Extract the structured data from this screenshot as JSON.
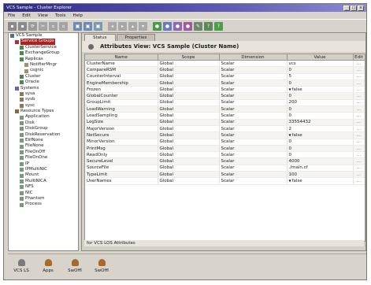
{
  "window": {
    "title": "VCS Sample - Cluster Explorer",
    "min": "_",
    "max": "□",
    "close": "×"
  },
  "menu": [
    "File",
    "Edit",
    "View",
    "Tools",
    "Help"
  ],
  "toolbar": {
    "icons": [
      {
        "name": "new-icon",
        "color": "#8a8a8a",
        "glyph": "▪"
      },
      {
        "name": "open-icon",
        "color": "#8a8a8a",
        "glyph": "▪"
      },
      {
        "name": "refresh-icon",
        "color": "#9a9a9a",
        "glyph": "⟳"
      },
      {
        "name": "cut-icon",
        "color": "#a4a4a4",
        "glyph": "✂"
      },
      {
        "name": "copy-icon",
        "color": "#a4a4a4",
        "glyph": "▫"
      },
      {
        "name": "paste-icon",
        "color": "#a4a4a4",
        "glyph": "▫"
      },
      {
        "name": "sep",
        "color": "",
        "glyph": ""
      },
      {
        "name": "add-group-icon",
        "color": "#6c8ab4",
        "glyph": "▣"
      },
      {
        "name": "add-resource-icon",
        "color": "#6c8ab4",
        "glyph": "▣"
      },
      {
        "name": "link-icon",
        "color": "#7a9ab0",
        "glyph": "▣"
      },
      {
        "name": "sep",
        "color": "",
        "glyph": ""
      },
      {
        "name": "back-icon",
        "color": "#a8a8a8",
        "glyph": "◂"
      },
      {
        "name": "forward-icon",
        "color": "#a8a8a8",
        "glyph": "▸"
      },
      {
        "name": "up-icon",
        "color": "#a8a8a8",
        "glyph": "▴"
      },
      {
        "name": "down-icon",
        "color": "#a8a8a8",
        "glyph": "▾"
      },
      {
        "name": "sep",
        "color": "",
        "glyph": ""
      },
      {
        "name": "online-icon",
        "color": "#4a9a4a",
        "glyph": "●"
      },
      {
        "name": "offline-icon",
        "color": "#6a7ac0",
        "glyph": "●"
      },
      {
        "name": "switch-icon",
        "color": "#8c6ab0",
        "glyph": "●"
      },
      {
        "name": "probe-icon",
        "color": "#a05aa0",
        "glyph": "●"
      },
      {
        "name": "wizard-icon",
        "color": "#6a8a6a",
        "glyph": "✎"
      },
      {
        "name": "query-icon",
        "color": "#5a8a5a",
        "glyph": "?"
      },
      {
        "name": "help-icon",
        "color": "#4aa04a",
        "glyph": "?"
      }
    ]
  },
  "tree": [
    {
      "label": "VCS Sample",
      "indent": 0,
      "icon": "#5a6a8a",
      "selected": false
    },
    {
      "label": "Service Groups",
      "indent": 1,
      "icon": "#b03030",
      "selected": true
    },
    {
      "label": "ClusterService",
      "indent": 2,
      "icon": "#4a8a4a",
      "selected": false
    },
    {
      "label": "ExchangeGroup",
      "indent": 2,
      "icon": "#4a8a4a",
      "selected": false
    },
    {
      "label": "Replicas",
      "indent": 2,
      "icon": "#4a8a4a",
      "selected": false
    },
    {
      "label": "NotifierMngr",
      "indent": 3,
      "icon": "#a09070",
      "selected": false
    },
    {
      "label": "csgnic",
      "indent": 3,
      "icon": "#a09070",
      "selected": false
    },
    {
      "label": "Cluster",
      "indent": 2,
      "icon": "#4a8a4a",
      "selected": false
    },
    {
      "label": "Oracle",
      "indent": 2,
      "icon": "#4a8a4a",
      "selected": false
    },
    {
      "label": "Systems",
      "indent": 1,
      "icon": "#6a6a9a",
      "selected": false
    },
    {
      "label": "sysa",
      "indent": 2,
      "icon": "#8a7a5a",
      "selected": false
    },
    {
      "label": "sysb",
      "indent": 2,
      "icon": "#8a7a5a",
      "selected": false
    },
    {
      "label": "sysc",
      "indent": 2,
      "icon": "#8a7a5a",
      "selected": false
    },
    {
      "label": "Resource Types",
      "indent": 1,
      "icon": "#8a6a3a",
      "selected": false
    },
    {
      "label": "Application",
      "indent": 2,
      "icon": "#7a9a7a",
      "selected": false
    },
    {
      "label": "Disk",
      "indent": 2,
      "icon": "#7a9a7a",
      "selected": false
    },
    {
      "label": "DiskGroup",
      "indent": 2,
      "icon": "#7a9a7a",
      "selected": false
    },
    {
      "label": "DiskReservation",
      "indent": 2,
      "icon": "#7a9a7a",
      "selected": false
    },
    {
      "label": "ElifNone",
      "indent": 2,
      "icon": "#7a9a7a",
      "selected": false
    },
    {
      "label": "FileNone",
      "indent": 2,
      "icon": "#7a9a7a",
      "selected": false
    },
    {
      "label": "FileOnOff",
      "indent": 2,
      "icon": "#7a9a7a",
      "selected": false
    },
    {
      "label": "FileOnOne",
      "indent": 2,
      "icon": "#7a9a7a",
      "selected": false
    },
    {
      "label": "IP",
      "indent": 2,
      "icon": "#7a9a7a",
      "selected": false
    },
    {
      "label": "IPMultiNIC",
      "indent": 2,
      "icon": "#7a9a7a",
      "selected": false
    },
    {
      "label": "Mount",
      "indent": 2,
      "icon": "#7a9a7a",
      "selected": false
    },
    {
      "label": "MultiNICA",
      "indent": 2,
      "icon": "#7a9a7a",
      "selected": false
    },
    {
      "label": "NFS",
      "indent": 2,
      "icon": "#7a9a7a",
      "selected": false
    },
    {
      "label": "NIC",
      "indent": 2,
      "icon": "#7a9a7a",
      "selected": false
    },
    {
      "label": "Phantom",
      "indent": 2,
      "icon": "#7a9a7a",
      "selected": false
    },
    {
      "label": "Process",
      "indent": 2,
      "icon": "#7a9a7a",
      "selected": false
    }
  ],
  "tabs": [
    {
      "label": "Status",
      "active": true
    },
    {
      "label": "Properties",
      "active": false
    }
  ],
  "attributes": {
    "title": "Attributes View: VCS Sample (Cluster Name)",
    "columns": [
      "Name",
      "Scope",
      "Dimension",
      "Value",
      "Edit"
    ],
    "rows": [
      {
        "name": "ClusterName",
        "scope": "Global",
        "dim": "Scalar",
        "value": "vcs",
        "dd": false,
        "edit": "…"
      },
      {
        "name": "CompareRSM",
        "scope": "Global",
        "dim": "Scalar",
        "value": "0",
        "dd": false,
        "edit": "…"
      },
      {
        "name": "CounterInterval",
        "scope": "Global",
        "dim": "Scalar",
        "value": "5",
        "dd": false,
        "edit": "…"
      },
      {
        "name": "EngineMembership",
        "scope": "Global",
        "dim": "Scalar",
        "value": "0",
        "dd": false,
        "edit": "…"
      },
      {
        "name": "Frozen",
        "scope": "Global",
        "dim": "Scalar",
        "value": "false",
        "dd": true,
        "edit": "…"
      },
      {
        "name": "GlobalCounter",
        "scope": "Global",
        "dim": "Scalar",
        "value": "0",
        "dd": false,
        "edit": "…"
      },
      {
        "name": "GroupLimit",
        "scope": "Global",
        "dim": "Scalar",
        "value": "200",
        "dd": false,
        "edit": "…"
      },
      {
        "name": "LoadWarning",
        "scope": "Global",
        "dim": "Scalar",
        "value": "0",
        "dd": false,
        "edit": "…"
      },
      {
        "name": "LoadSampling",
        "scope": "Global",
        "dim": "Scalar",
        "value": "0",
        "dd": false,
        "edit": "…"
      },
      {
        "name": "LogSize",
        "scope": "Global",
        "dim": "Scalar",
        "value": "33554432",
        "dd": false,
        "edit": "…"
      },
      {
        "name": "MajorVersion",
        "scope": "Global",
        "dim": "Scalar",
        "value": "2",
        "dd": false,
        "edit": "…"
      },
      {
        "name": "NetSecure",
        "scope": "Global",
        "dim": "Scalar",
        "value": "false",
        "dd": true,
        "edit": "…"
      },
      {
        "name": "MinorVersion",
        "scope": "Global",
        "dim": "Scalar",
        "value": "0",
        "dd": false,
        "edit": "…"
      },
      {
        "name": "PrintMsg",
        "scope": "Global",
        "dim": "Scalar",
        "value": "0",
        "dd": false,
        "edit": "…"
      },
      {
        "name": "ReadOnly",
        "scope": "Global",
        "dim": "Scalar",
        "value": "0",
        "dd": false,
        "edit": "…"
      },
      {
        "name": "SecureLevel",
        "scope": "Global",
        "dim": "Scalar",
        "value": "4000",
        "dd": false,
        "edit": "…"
      },
      {
        "name": "SourceFile",
        "scope": "Global",
        "dim": "Scalar",
        "value": "./main.cf",
        "dd": false,
        "edit": "…"
      },
      {
        "name": "TypeLimit",
        "scope": "Global",
        "dim": "Scalar",
        "value": "100",
        "dd": false,
        "edit": "…"
      },
      {
        "name": "UserNames",
        "scope": "Global",
        "dim": "Scalar",
        "value": "false",
        "dd": true,
        "edit": "…"
      }
    ]
  },
  "status": "for VCS LOS Attributes",
  "bottom_buttons": [
    {
      "label": "VCS LS",
      "icon": "grey"
    },
    {
      "label": "Apps",
      "icon": "brown"
    },
    {
      "label": "SwOffl",
      "icon": "brown"
    },
    {
      "label": "SwOffl",
      "icon": "brown"
    }
  ]
}
